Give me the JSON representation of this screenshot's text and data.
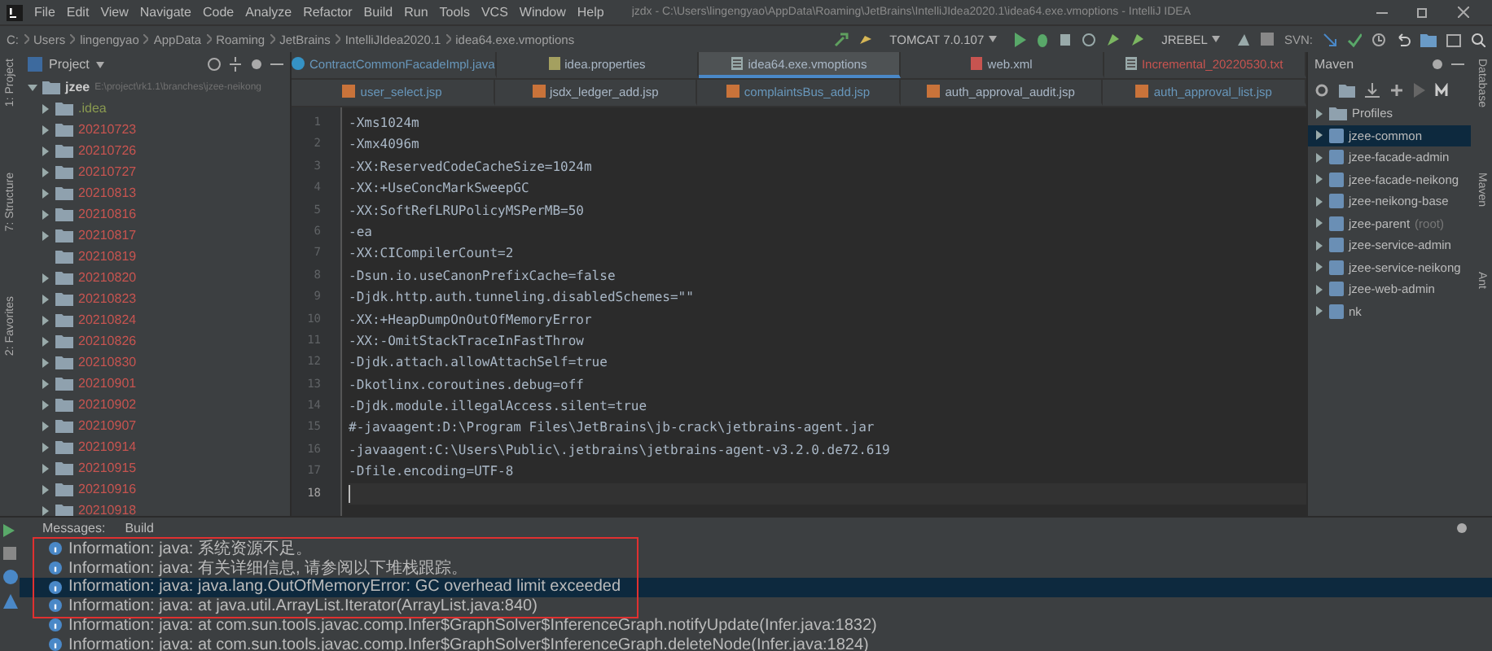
{
  "menu_bar": {
    "items": [
      "File",
      "Edit",
      "View",
      "Navigate",
      "Code",
      "Analyze",
      "Refactor",
      "Build",
      "Run",
      "Tools",
      "VCS",
      "Window",
      "Help"
    ],
    "title": "jzdx - C:\\Users\\lingengyao\\AppData\\Roaming\\JetBrains\\IntelliJIdea2020.1\\idea64.exe.vmoptions - IntelliJ IDEA"
  },
  "breadcrumb": [
    "C:",
    "Users",
    "lingengyao",
    "AppData",
    "Roaming",
    "JetBrains",
    "IntelliJIdea2020.1",
    "idea64.exe.vmoptions"
  ],
  "toolbar": {
    "run_config": "TOMCAT 7.0.107",
    "jrebel": "JREBEL",
    "svn_label": "SVN:"
  },
  "left_stripe": [
    "1: Project",
    "7: Structure",
    "2: Favorites"
  ],
  "project": {
    "title": "Project",
    "root": {
      "name": "jzee",
      "path": "E:\\project\\rk1.1\\branches\\jzee-neikong",
      "expanded": true,
      "children": [
        {
          "name": ".idea",
          "expandable": true,
          "color": "#8a9a50"
        },
        {
          "name": "20210723",
          "expandable": true,
          "color": "#c75450"
        },
        {
          "name": "20210726",
          "expandable": true,
          "color": "#c75450"
        },
        {
          "name": "20210727",
          "expandable": true,
          "color": "#c75450"
        },
        {
          "name": "20210813",
          "expandable": true,
          "color": "#c75450"
        },
        {
          "name": "20210816",
          "expandable": true,
          "color": "#c75450"
        },
        {
          "name": "20210817",
          "expandable": true,
          "color": "#c75450"
        },
        {
          "name": "20210819",
          "expandable": false,
          "color": "#c75450"
        },
        {
          "name": "20210820",
          "expandable": true,
          "color": "#c75450"
        },
        {
          "name": "20210823",
          "expandable": true,
          "color": "#c75450"
        },
        {
          "name": "20210824",
          "expandable": true,
          "color": "#c75450"
        },
        {
          "name": "20210826",
          "expandable": true,
          "color": "#c75450"
        },
        {
          "name": "20210830",
          "expandable": true,
          "color": "#c75450"
        },
        {
          "name": "20210901",
          "expandable": true,
          "color": "#c75450"
        },
        {
          "name": "20210902",
          "expandable": true,
          "color": "#c75450"
        },
        {
          "name": "20210907",
          "expandable": true,
          "color": "#c75450"
        },
        {
          "name": "20210914",
          "expandable": true,
          "color": "#c75450"
        },
        {
          "name": "20210915",
          "expandable": true,
          "color": "#c75450"
        },
        {
          "name": "20210916",
          "expandable": true,
          "color": "#c75450"
        },
        {
          "name": "20210918",
          "expandable": true,
          "color": "#c75450"
        }
      ]
    }
  },
  "editor_tabs": [
    [
      {
        "label": "ContractCommonFacadeImpl.java",
        "kind": "java",
        "color": "#6897bb",
        "selected": false
      },
      {
        "label": "idea.properties",
        "kind": "properties",
        "color": "#a9b7c6",
        "selected": false
      },
      {
        "label": "idea64.exe.vmoptions",
        "kind": "text",
        "color": "#a9b7c6",
        "selected": true
      },
      {
        "label": "web.xml",
        "kind": "xml",
        "color": "#a9b7c6",
        "selected": false
      },
      {
        "label": "Incremental_20220530.txt",
        "kind": "text",
        "color": "#c75450",
        "selected": false
      }
    ],
    [
      {
        "label": "user_select.jsp",
        "kind": "jsp",
        "color": "#6897bb",
        "selected": false
      },
      {
        "label": "jsdx_ledger_add.jsp",
        "kind": "jsp",
        "color": "#a9b7c6",
        "selected": false
      },
      {
        "label": "complaintsBus_add.jsp",
        "kind": "jsp",
        "color": "#6897bb",
        "selected": false
      },
      {
        "label": "auth_approval_audit.jsp",
        "kind": "jsp",
        "color": "#a9b7c6",
        "selected": false
      },
      {
        "label": "auth_approval_list.jsp",
        "kind": "jsp",
        "color": "#6897bb",
        "selected": false
      }
    ]
  ],
  "editor_lines": [
    {
      "number": "1",
      "text": "-Xms1024m",
      "current": false
    },
    {
      "number": "2",
      "text": "-Xmx4096m",
      "current": false
    },
    {
      "number": "3",
      "text": "-XX:ReservedCodeCacheSize=1024m",
      "current": false
    },
    {
      "number": "4",
      "text": "-XX:+UseConcMarkSweepGC",
      "current": false
    },
    {
      "number": "5",
      "text": "-XX:SoftRefLRUPolicyMSPerMB=50",
      "current": false
    },
    {
      "number": "6",
      "text": "-ea",
      "current": false
    },
    {
      "number": "7",
      "text": "-XX:CICompilerCount=2",
      "current": false
    },
    {
      "number": "8",
      "text": "-Dsun.io.useCanonPrefixCache=false",
      "current": false
    },
    {
      "number": "9",
      "text": "-Djdk.http.auth.tunneling.disabledSchemes=\"\"",
      "current": false
    },
    {
      "number": "10",
      "text": "-XX:+HeapDumpOnOutOfMemoryError",
      "current": false
    },
    {
      "number": "11",
      "text": "-XX:-OmitStackTraceInFastThrow",
      "current": false
    },
    {
      "number": "12",
      "text": "-Djdk.attach.allowAttachSelf=true",
      "current": false
    },
    {
      "number": "13",
      "text": "-Dkotlinx.coroutines.debug=off",
      "current": false
    },
    {
      "number": "14",
      "text": "-Djdk.module.illegalAccess.silent=true",
      "current": false
    },
    {
      "number": "15",
      "text": "#-javaagent:D:\\Program Files\\JetBrains\\jb-crack\\jetbrains-agent.jar",
      "current": false
    },
    {
      "number": "16",
      "text": "-javaagent:C:\\Users\\Public\\.jetbrains\\jetbrains-agent-v3.2.0.de72.619",
      "current": false
    },
    {
      "number": "17",
      "text": "-Dfile.encoding=UTF-8",
      "current": false
    },
    {
      "number": "18",
      "current": true
    }
  ],
  "maven": {
    "title": "Maven",
    "items": [
      {
        "name": "Profiles",
        "kind": "profiles",
        "selected": false
      },
      {
        "name": "jzee-common",
        "kind": "module",
        "selected": true
      },
      {
        "name": "jzee-facade-admin",
        "kind": "module",
        "selected": false
      },
      {
        "name": "jzee-facade-neikong",
        "kind": "module",
        "selected": false
      },
      {
        "name": "jzee-neikong-base",
        "kind": "module",
        "selected": false
      },
      {
        "name": "jzee-parent",
        "note": "(root)",
        "kind": "module",
        "selected": false
      },
      {
        "name": "jzee-service-admin",
        "kind": "module",
        "selected": false
      },
      {
        "name": "jzee-service-neikong",
        "kind": "module",
        "selected": false
      },
      {
        "name": "jzee-web-admin",
        "kind": "module",
        "selected": false
      },
      {
        "name": "nk",
        "kind": "module",
        "selected": false
      }
    ]
  },
  "right_stripe": [
    "Database",
    "Maven",
    "Ant"
  ],
  "messages": {
    "tabs": [
      "Messages:",
      "Build"
    ],
    "rows": [
      {
        "text": "Information: java: 系统资源不足。",
        "selected": false
      },
      {
        "text": "Information: java: 有关详细信息, 请参阅以下堆栈跟踪。",
        "selected": false
      },
      {
        "text": "Information: java: java.lang.OutOfMemoryError: GC overhead limit exceeded",
        "selected": true
      },
      {
        "text": "Information: java: at java.util.ArrayList.Iterator(ArrayList.java:840)",
        "selected": false
      },
      {
        "text": "Information: java: at com.sun.tools.javac.comp.Infer$GraphSolver$InferenceGraph.notifyUpdate(Infer.java:1832)",
        "selected": false
      },
      {
        "text": "Information: java: at com.sun.tools.javac.comp.Infer$GraphSolver$InferenceGraph.deleteNode(Infer.java:1824)",
        "selected": false
      }
    ]
  }
}
